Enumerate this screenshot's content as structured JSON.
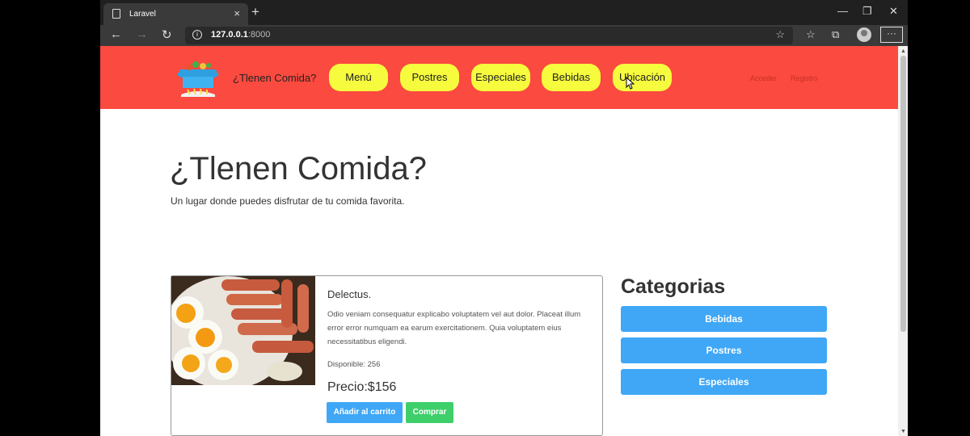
{
  "browser": {
    "tab_title": "Laravel",
    "tab_close": "×",
    "new_tab": "+",
    "url_host": "127.0.0.1",
    "url_port": ":8000",
    "minimize": "—",
    "restore": "❐",
    "close": "✕",
    "more": "···"
  },
  "header": {
    "brand": "¿Tlenen Comida?",
    "nav": [
      "Menú",
      "Postres",
      "Especiales",
      "Bebidas",
      "Ubicación"
    ],
    "login": "Acceder",
    "register": "Registro"
  },
  "hero": {
    "title": "¿Tlenen Comida?",
    "subtitle": "Un lugar donde puedes disfrutar de tu comida favorita."
  },
  "product": {
    "name": "Delectus.",
    "description": "Odio veniam consequatur explicabo voluptatem vel aut dolor. Placeat illum error error numquam ea earum exercitationem. Quia voluptatem eius necessitatibus eligendi.",
    "stock": "Disponible: 256",
    "price": "Precio:$156",
    "add_to_cart": "Añadir al carrito",
    "buy": "Comprar"
  },
  "categories": {
    "title": "Categorias",
    "items": [
      "Bebidas",
      "Postres",
      "Especiales"
    ]
  },
  "colors": {
    "header_bg": "#fb4a3f",
    "nav_pill": "#f6fb3e",
    "primary": "#3fa7f6",
    "success": "#3ecf6a"
  }
}
